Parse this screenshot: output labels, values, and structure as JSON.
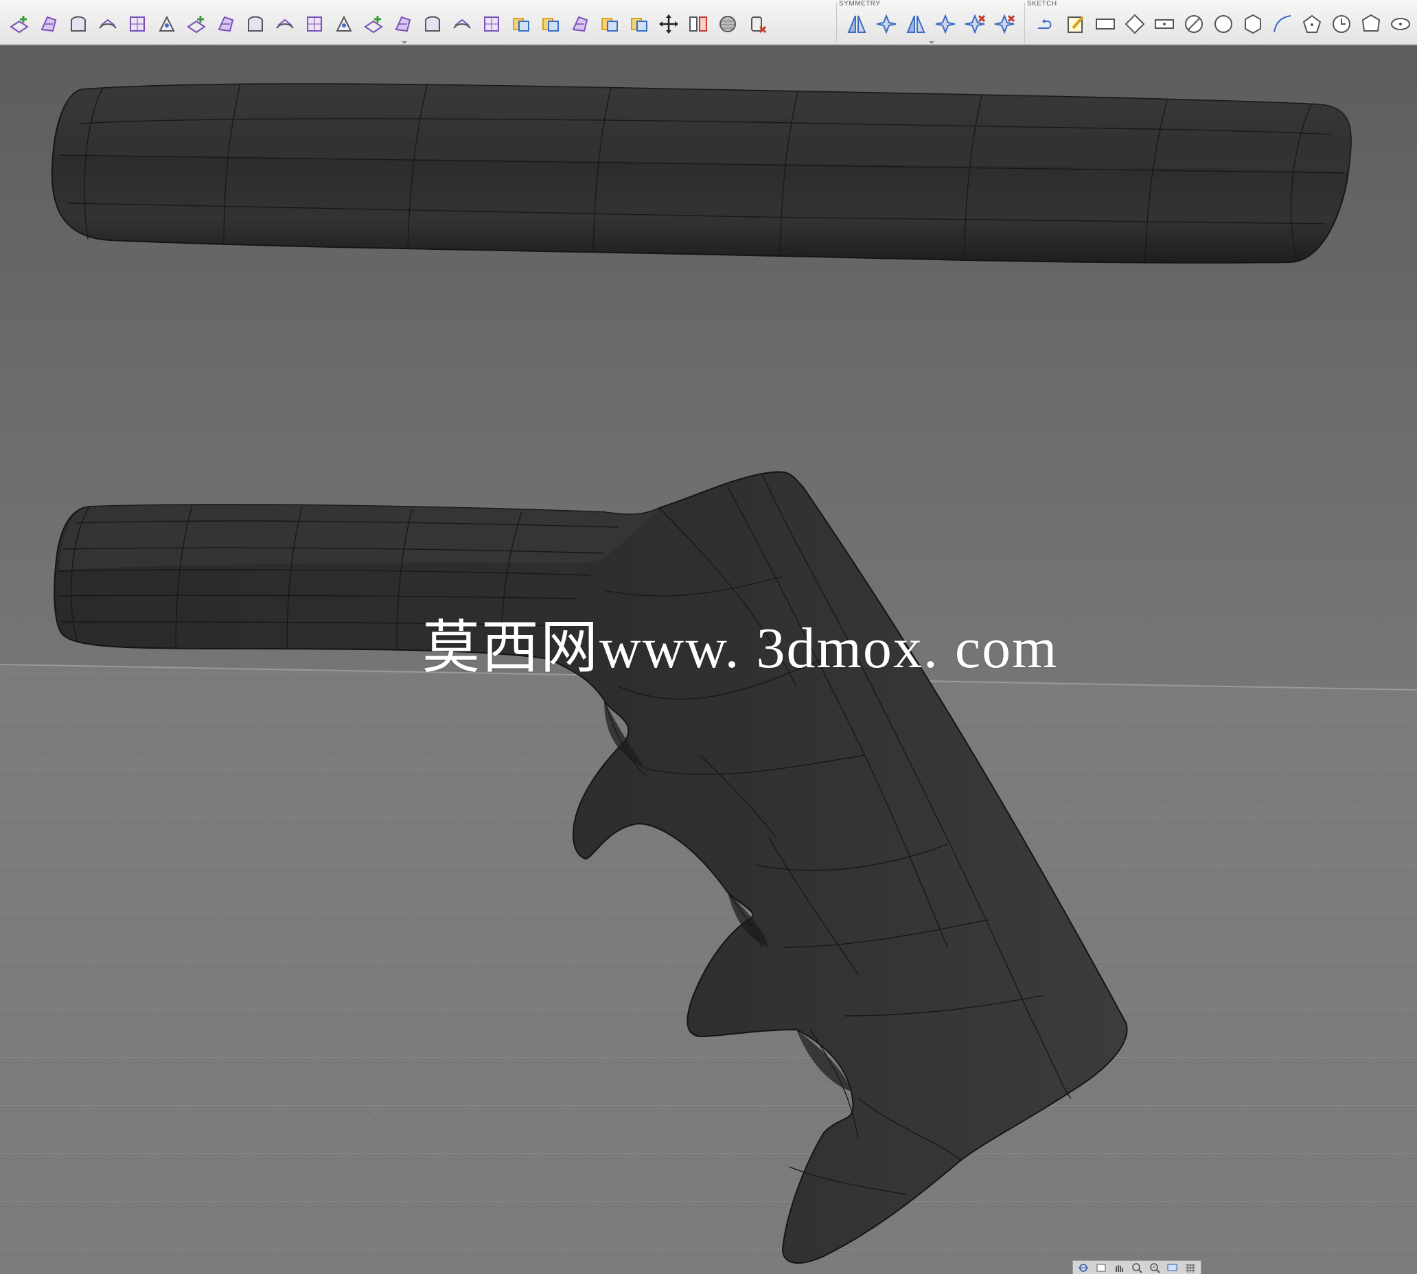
{
  "toolbar": {
    "symmetry_label": "SYMMETRY",
    "sketch_label": "SKETCH",
    "modify_tools": [
      "insert-edge-icon",
      "insert-point-icon",
      "subdivide-icon",
      "bridge-icon",
      "fill-hole-icon",
      "weld-vertices-icon",
      "unweld-edges-icon",
      "crease-icon",
      "uncrease-icon",
      "bevel-edge-icon",
      "slide-edge-icon",
      "pull-icon",
      "flatten-icon",
      "straighten-icon",
      "match-icon",
      "interpolate-icon",
      "thicken-icon",
      "freeze-icon",
      "unfreeze-icon",
      "make-uniform-icon",
      "convert-icon",
      "merge-bodies-icon",
      "edit-form-move-icon",
      "mirror-body-icon",
      "display-mode-icon",
      "delete-icon"
    ],
    "symmetry_tools": [
      "mirror-internal-icon",
      "circular-internal-icon",
      "mirror-duplicate-icon",
      "circular-duplicate-icon",
      "clear-symmetry-icon",
      "isolate-symmetry-icon"
    ],
    "sketch_tools": [
      "line-icon",
      "create-sketch-icon",
      "rectangle-icon",
      "diamond-icon",
      "slot-icon",
      "circle-diameter-icon",
      "circle-icon",
      "polygon-icon",
      "arc-icon",
      "pentagon-icon",
      "clock-icon",
      "shield-icon",
      "ellipse-icon"
    ]
  },
  "viewport": {
    "watermark": "莫西网www. 3dmox. com",
    "background_color": "#6e6e6e",
    "mesh_color": "#2e2e2e"
  },
  "navbar": {
    "buttons": [
      "orbit-icon",
      "look-at-icon",
      "pan-icon",
      "zoom-icon",
      "fit-icon",
      "display-settings-icon",
      "grid-settings-icon"
    ]
  }
}
